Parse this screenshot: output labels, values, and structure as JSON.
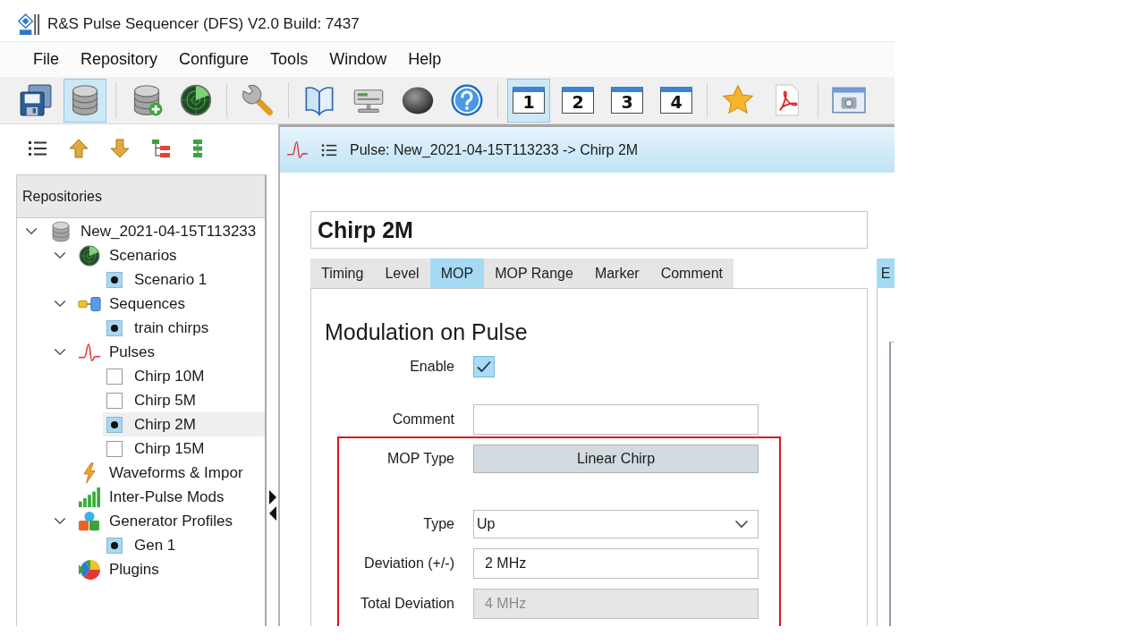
{
  "window": {
    "title": "R&S Pulse Sequencer (DFS) V2.0 Build: 7437"
  },
  "menu": [
    "File",
    "Repository",
    "Configure",
    "Tools",
    "Window",
    "Help"
  ],
  "toolbar": [
    {
      "items": [
        {
          "kind": "save",
          "selected": false
        },
        {
          "kind": "database",
          "selected": true
        }
      ]
    },
    {
      "items": [
        {
          "kind": "database-add",
          "selected": false
        },
        {
          "kind": "radar",
          "selected": false
        }
      ]
    },
    {
      "items": [
        {
          "kind": "wrench",
          "selected": false
        }
      ]
    },
    {
      "items": [
        {
          "kind": "book",
          "selected": false
        },
        {
          "kind": "computer",
          "selected": false
        },
        {
          "kind": "sphere",
          "selected": false
        },
        {
          "kind": "help",
          "selected": false
        }
      ]
    },
    {
      "items": [
        {
          "kind": "window",
          "label": "1",
          "selected": true
        },
        {
          "kind": "window",
          "label": "2",
          "selected": false
        },
        {
          "kind": "window",
          "label": "3",
          "selected": false
        },
        {
          "kind": "window",
          "label": "4",
          "selected": false
        }
      ]
    },
    {
      "items": [
        {
          "kind": "star",
          "selected": false
        },
        {
          "kind": "pdf",
          "selected": false
        }
      ]
    },
    {
      "items": [
        {
          "kind": "screenshot",
          "selected": false
        }
      ]
    }
  ],
  "repository_panel": {
    "toolbar": [
      {
        "kind": "list"
      },
      {
        "kind": "up"
      },
      {
        "kind": "down"
      },
      {
        "kind": "tree"
      },
      {
        "kind": "nodes"
      }
    ],
    "title": "Repositories",
    "tree": [
      {
        "kind": "repository",
        "label": "New_2021-04-15T113233",
        "expanded": true,
        "selected": false,
        "children": [
          {
            "kind": "scenarios",
            "label": "Scenarios",
            "expanded": true,
            "selected": false,
            "children": [
              {
                "kind": "item",
                "label": "Scenario 1",
                "active": true,
                "selected": false
              }
            ]
          },
          {
            "kind": "sequences",
            "label": "Sequences",
            "expanded": true,
            "selected": false,
            "children": [
              {
                "kind": "item",
                "label": "train chirps",
                "active": true,
                "selected": false
              }
            ]
          },
          {
            "kind": "pulses",
            "label": "Pulses",
            "expanded": true,
            "selected": false,
            "children": [
              {
                "kind": "item",
                "label": "Chirp 10M",
                "active": false,
                "selected": false
              },
              {
                "kind": "item",
                "label": "Chirp 5M",
                "active": false,
                "selected": false
              },
              {
                "kind": "item",
                "label": "Chirp 2M",
                "active": true,
                "selected": true
              },
              {
                "kind": "item",
                "label": "Chirp 15M",
                "active": false,
                "selected": false
              }
            ]
          },
          {
            "kind": "waveforms",
            "label": "Waveforms & Impor",
            "selected": false
          },
          {
            "kind": "modulations",
            "label": "Inter-Pulse Mods",
            "selected": false
          },
          {
            "kind": "generators",
            "label": "Generator Profiles",
            "expanded": true,
            "selected": false,
            "children": [
              {
                "kind": "item",
                "label": "Gen 1",
                "active": true,
                "selected": false
              }
            ]
          },
          {
            "kind": "plugins",
            "label": "Plugins",
            "selected": false
          }
        ]
      }
    ]
  },
  "editor": {
    "title": "Pulse: New_2021-04-15T113233 -> Chirp 2M",
    "name": "Chirp 2M",
    "tabs": [
      {
        "label": "Timing",
        "selected": false
      },
      {
        "label": "Level",
        "selected": false
      },
      {
        "label": "MOP",
        "selected": true
      },
      {
        "label": "MOP Range",
        "selected": false
      },
      {
        "label": "Marker",
        "selected": false
      },
      {
        "label": "Comment",
        "selected": false
      }
    ],
    "section_title": "Modulation on Pulse",
    "fields": [
      {
        "kind": "checkbox",
        "label": "Enable",
        "checked": true,
        "disabled": false
      },
      {
        "kind": "text",
        "label": "Comment",
        "disabled": false
      }
    ],
    "highlighted_fields": [
      {
        "kind": "button",
        "label": "MOP Type",
        "value": "Linear Chirp",
        "disabled": false
      },
      {
        "kind": "select",
        "label": "Type",
        "value": "Up",
        "disabled": false
      },
      {
        "kind": "text",
        "label": "Deviation (+/-)",
        "value": "2 MHz",
        "disabled": false
      },
      {
        "kind": "text",
        "label": "Total Deviation",
        "value": "4 MHz",
        "disabled": true
      }
    ]
  },
  "side_panel": {
    "tabs": [
      {
        "label": "E",
        "selected": true
      }
    ]
  }
}
